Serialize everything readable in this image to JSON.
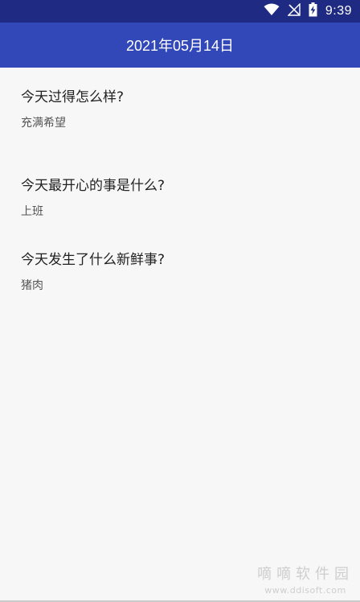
{
  "status_bar": {
    "time": "9:39",
    "icons": [
      "wifi-icon",
      "no-signal-icon",
      "battery-charging-icon"
    ],
    "background": "#1f2b83"
  },
  "app_bar": {
    "title": "2021年05月14日",
    "background": "#3248b8"
  },
  "entries": [
    {
      "question": "今天过得怎么样?",
      "answer": "充满希望"
    },
    {
      "question": "今天最开心的事是什么?",
      "answer": "上班"
    },
    {
      "question": "今天发生了什么新鲜事?",
      "answer": "猪肉"
    }
  ],
  "watermark": {
    "title": "嘀嘀软件园",
    "url": "www.ddisoft.com"
  }
}
